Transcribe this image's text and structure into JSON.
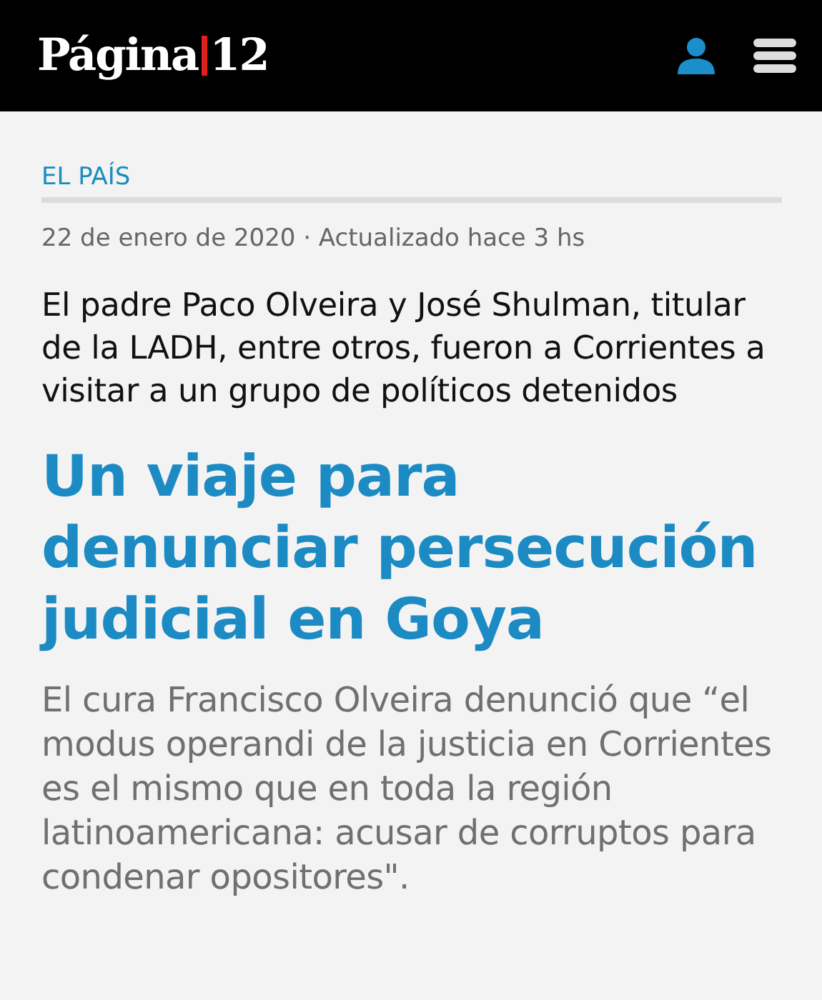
{
  "header": {
    "logo_name": "Página",
    "logo_number": "12"
  },
  "article": {
    "section": "EL PAÍS",
    "date": "22 de enero de 2020 · Actualizado hace 3 hs",
    "subtitle": "El padre Paco Olveira y José Shulman, titular de la LADH, entre otros, fueron a Corrientes a visitar a un grupo de políticos detenidos",
    "title": "Un viaje para denunciar persecución judicial en Goya",
    "summary": "El cura Francisco Olveira denunció que “el modus operandi de la justicia en Corrientes es el mismo que en toda la región latinoamericana: acusar de corruptos para condenar opositores\"."
  }
}
